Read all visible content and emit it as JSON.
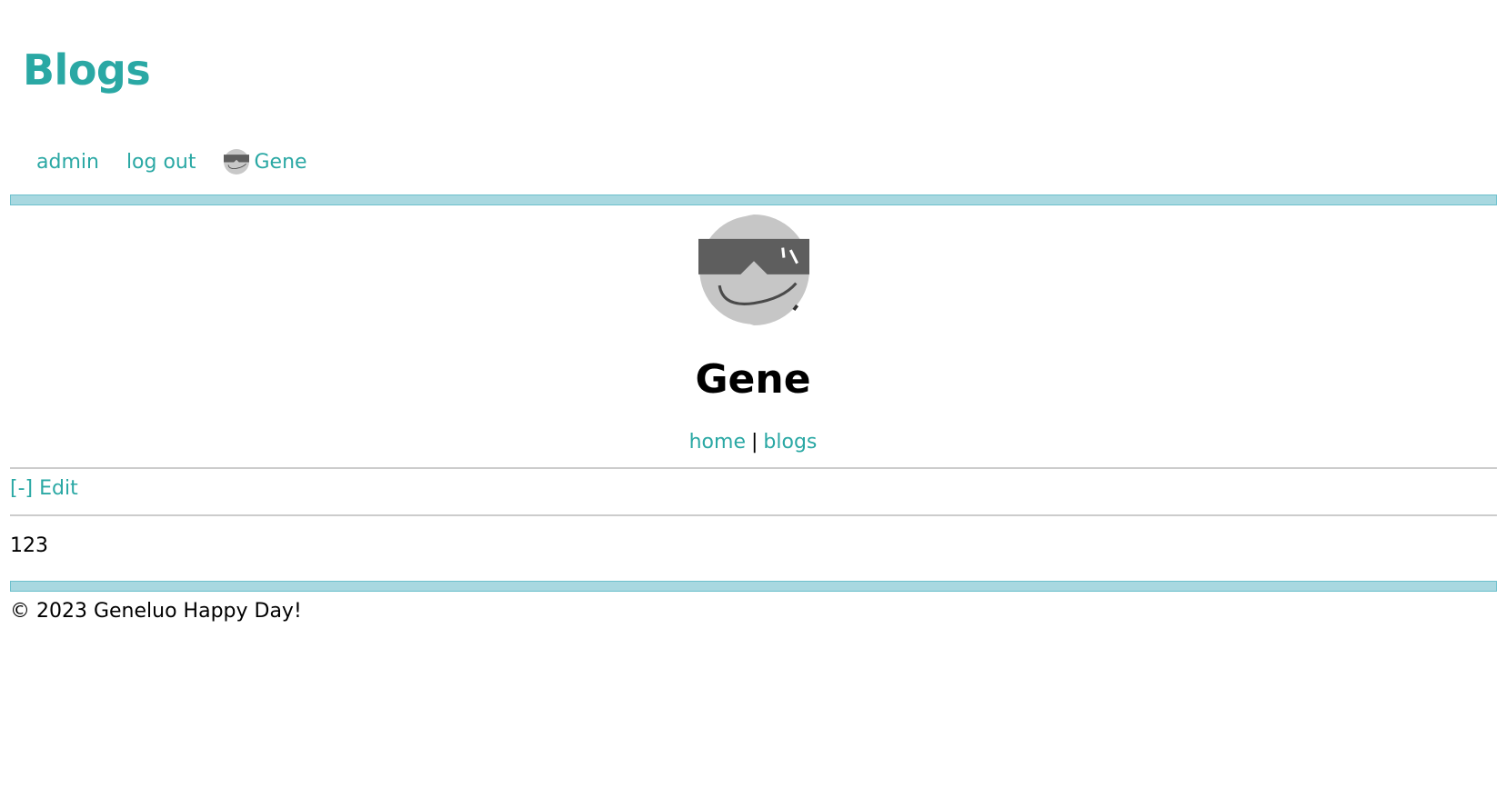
{
  "site": {
    "title": "Blogs",
    "accent_color": "#2aa8a4",
    "bar_color": "#a8d8e0"
  },
  "nav": {
    "admin_label": "admin",
    "logout_label": "log out",
    "user_label": "Gene",
    "user_icon": "avatar-sunglasses-icon"
  },
  "profile": {
    "name": "Gene",
    "avatar_icon": "avatar-sunglasses-icon",
    "links": {
      "home_label": "home",
      "separator": "|",
      "blogs_label": "blogs"
    }
  },
  "content": {
    "edit_toggle_label": "[-] Edit",
    "body_text": "123"
  },
  "footer": {
    "text": "© 2023 Geneluo Happy Day!"
  }
}
